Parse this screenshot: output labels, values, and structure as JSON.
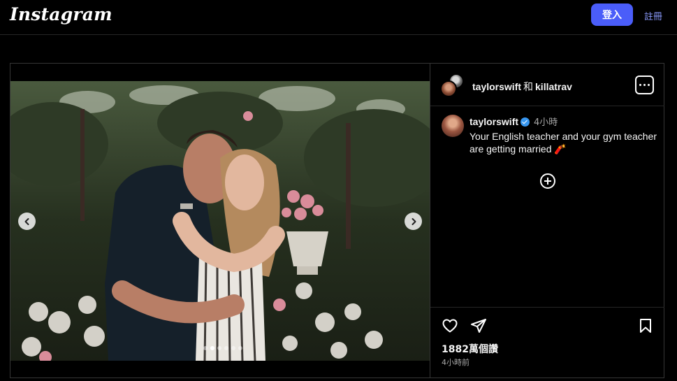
{
  "header": {
    "logo": "Instagram",
    "login_label": "登入",
    "signup_label": "註冊"
  },
  "post": {
    "collab_user_1": "taylorswift",
    "collab_joiner": "和",
    "collab_user_2": "killatrav",
    "caption": {
      "username": "taylorswift",
      "verified": true,
      "time": "4小時",
      "text": "Your English teacher and your gym teacher are getting married 🧨"
    },
    "likes": "1882萬個讚",
    "posted_ago": "4小時前",
    "carousel": {
      "slides": 6,
      "active_index": 1
    },
    "icons": {
      "more": "more-options-icon",
      "add": "add-comment-icon",
      "like": "heart-icon",
      "share": "paper-plane-icon",
      "save": "bookmark-icon",
      "prev": "chevron-left-icon",
      "next": "chevron-right-icon"
    }
  },
  "colors": {
    "background": "#000000",
    "login_button": "#4a5df9",
    "signup_link": "#8c9cff",
    "verified": "#3897f0",
    "border": "#363636"
  }
}
